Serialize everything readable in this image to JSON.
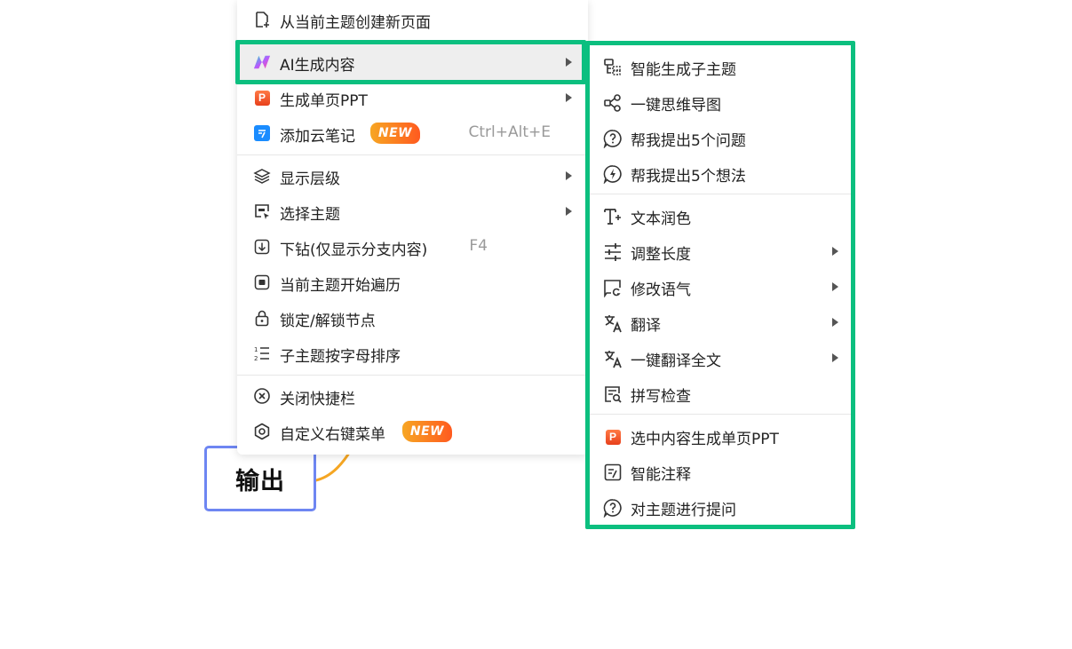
{
  "node": {
    "label": "输出"
  },
  "menu": {
    "items": [
      {
        "label": "从当前主题创建新页面",
        "icon": "new-page-icon"
      },
      {
        "label": "AI生成内容",
        "icon": "ai-logo-icon",
        "submenu": true,
        "highlighted": true
      },
      {
        "label": "生成单页PPT",
        "icon": "ppt-icon",
        "submenu": true
      },
      {
        "label": "添加云笔记",
        "icon": "cloud-note-icon",
        "badge": "NEW",
        "shortcut": "Ctrl+Alt+E"
      },
      {
        "label": "显示层级",
        "icon": "layers-icon",
        "submenu": true
      },
      {
        "label": "选择主题",
        "icon": "select-topic-icon",
        "submenu": true
      },
      {
        "label": "下钻(仅显示分支内容)",
        "icon": "drill-down-icon",
        "shortcut": "F4"
      },
      {
        "label": "当前主题开始遍历",
        "icon": "traverse-icon"
      },
      {
        "label": "锁定/解锁节点",
        "icon": "lock-icon"
      },
      {
        "label": "子主题按字母排序",
        "icon": "sort-list-icon"
      },
      {
        "label": "关闭快捷栏",
        "icon": "close-circle-icon"
      },
      {
        "label": "自定义右键菜单",
        "icon": "settings-gear-icon",
        "badge": "NEW"
      }
    ],
    "ppt_glyph": "P"
  },
  "submenu": {
    "items": [
      {
        "label": "智能生成子主题",
        "icon": "subtopic-tree-icon"
      },
      {
        "label": "一键思维导图",
        "icon": "mindmap-share-icon"
      },
      {
        "label": "帮我提出5个问题",
        "icon": "question-circle-icon"
      },
      {
        "label": "帮我提出5个想法",
        "icon": "idea-bulb-icon"
      },
      {
        "label": "文本润色",
        "icon": "text-polish-icon"
      },
      {
        "label": "调整长度",
        "icon": "adjust-sliders-icon",
        "submenu": true
      },
      {
        "label": "修改语气",
        "icon": "tone-chat-icon",
        "submenu": true
      },
      {
        "label": "翻译",
        "icon": "translate-icon",
        "submenu": true
      },
      {
        "label": "一键翻译全文",
        "icon": "translate-all-icon",
        "submenu": true
      },
      {
        "label": "拼写检查",
        "icon": "spell-check-icon"
      },
      {
        "label": "选中内容生成单页PPT",
        "icon": "ppt-icon"
      },
      {
        "label": "智能注释",
        "icon": "smart-note-icon"
      },
      {
        "label": "对主题进行提问",
        "icon": "ask-question-icon"
      }
    ]
  },
  "colors": {
    "highlight_border": "#0cbf7f",
    "node_border": "#6e86f2",
    "connector": "#f5a623",
    "badge_start": "#f7a623",
    "badge_end": "#ff5a1f"
  }
}
